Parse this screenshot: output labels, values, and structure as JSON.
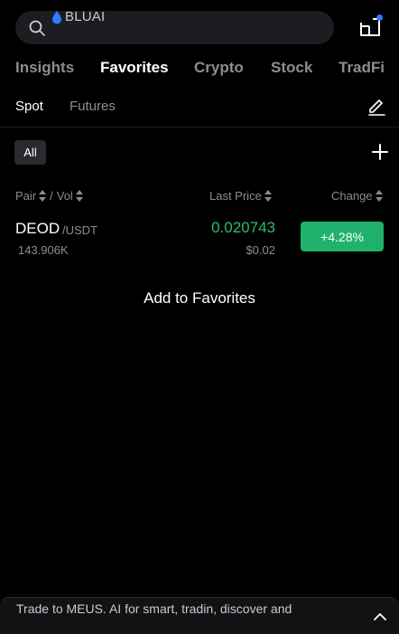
{
  "search": {
    "placeholder": "BLUAI"
  },
  "main_tabs": [
    {
      "label": "Insights",
      "active": false
    },
    {
      "label": "Favorites",
      "active": true
    },
    {
      "label": "Crypto",
      "active": false
    },
    {
      "label": "Stock",
      "active": false
    },
    {
      "label": "TradFi",
      "active": false
    }
  ],
  "sub_tabs": [
    {
      "label": "Spot",
      "active": true
    },
    {
      "label": "Futures",
      "active": false
    }
  ],
  "filter": {
    "all_label": "All"
  },
  "columns": {
    "pair": "Pair",
    "separator": "/",
    "vol": "Vol",
    "last_price": "Last Price",
    "change": "Change"
  },
  "rows": [
    {
      "base": "DEOD",
      "quote": "/USDT",
      "volume": "143.906K",
      "last_price": "0.020743",
      "usd_price": "$0.02",
      "change": "+4.28%"
    }
  ],
  "add_favorites_label": "Add to Favorites",
  "bottom_banner": {
    "text": "Trade to MEUS. AI for smart, tradin, discover and"
  },
  "colors": {
    "background": "#000000",
    "accent_up": "#2ebd6f",
    "badge_up": "#20b26c",
    "notification": "#2f7bff",
    "muted": "#8b8d92"
  }
}
